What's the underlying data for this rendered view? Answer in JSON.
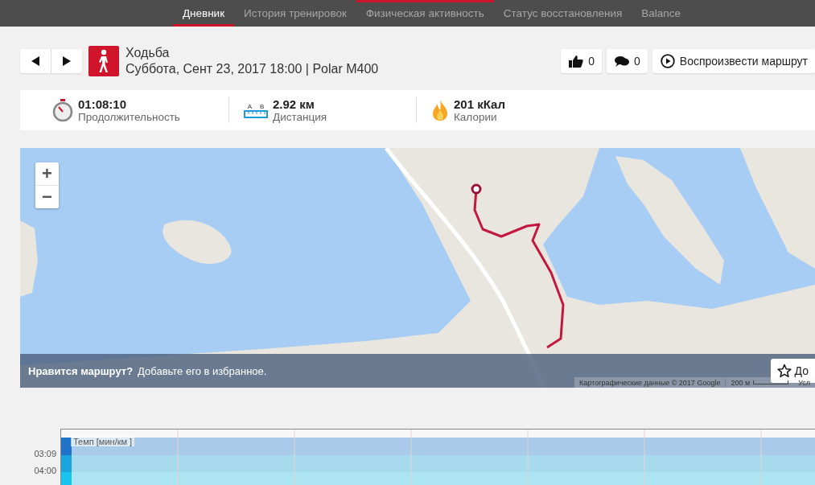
{
  "nav": {
    "tabs": [
      {
        "label": "Дневник",
        "selected": true,
        "hovered": false
      },
      {
        "label": "История тренировок",
        "selected": false,
        "hovered": false
      },
      {
        "label": "Физическая активность",
        "selected": false,
        "hovered": true
      },
      {
        "label": "Статус восстановления",
        "selected": false,
        "hovered": false
      },
      {
        "label": "Balance",
        "selected": false,
        "hovered": false
      }
    ]
  },
  "activity": {
    "sport": "Ходьба",
    "subtitle": "Суббота, Сент 23, 2017 18:00 | Polar M400"
  },
  "actions": [
    {
      "kind": "like",
      "text": "0"
    },
    {
      "kind": "comment",
      "text": "0"
    },
    {
      "kind": "play",
      "text": "Воспроизвести маршрут"
    }
  ],
  "stats": [
    {
      "kind": "duration",
      "value": "01:08:10",
      "label": "Продолжительность"
    },
    {
      "kind": "distance",
      "value": "2.92 км",
      "label": "Дистанция",
      "marks": [
        "A",
        "B"
      ]
    },
    {
      "kind": "calories",
      "value": "201 кКал",
      "label": "Калории"
    }
  ],
  "map": {
    "zoom_in": "+",
    "zoom_out": "−",
    "banner": {
      "question": "Нравится маршрут?",
      "text": "Добавьте его в избранное.",
      "button": "До"
    },
    "attribution": "Картографические данные © 2017 Google",
    "scale": "200 м",
    "terms": "Усл"
  },
  "chart": {
    "series_label": "Темп [мин/км ]",
    "y_labels": [
      "03:09",
      "04:00"
    ]
  }
}
